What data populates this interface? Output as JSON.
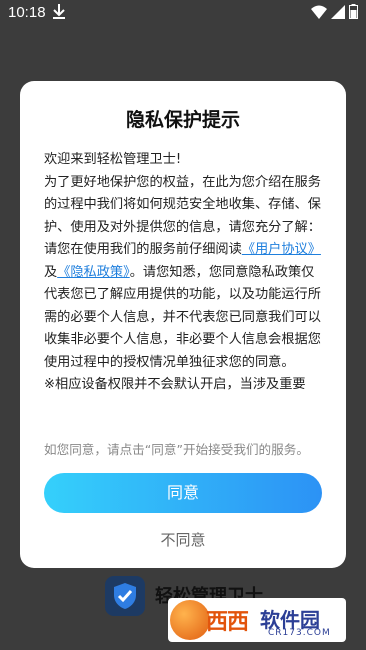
{
  "status_bar": {
    "time": "10:18"
  },
  "dialog": {
    "title": "隐私保护提示",
    "greeting": "欢迎来到轻松管理卫士!",
    "para1": "为了更好地保护您的权益，在此为您介绍在服务的过程中我们将如何规范安全地收集、存储、保护、使用及对外提供您的信息，请您充分了解：",
    "para2_prefix": "请您在使用我们的服务前仔细阅读",
    "user_agreement_link": "《用户协议》",
    "and_text": "及",
    "privacy_link": "《隐私政策》",
    "para2_suffix": "。请您知悉，您同意隐私政策仅代表您已了解应用提供的功能，以及功能运行所需的必要个人信息，并不代表您已同意我们可以收集非必要个人信息，非必要个人信息会根据您使用过程中的授权情况单独征求您的同意。",
    "para3": "※相应设备权限并不会默认开启，当涉及重要",
    "hint": "如您同意，请点击“同意”开始接受我们的服务。",
    "agree_label": "同意",
    "disagree_label": "不同意"
  },
  "background_app": {
    "name": "轻松管理卫士"
  },
  "watermark": {
    "xixi": "西西",
    "main": "软件园",
    "sub": "CR173.COM"
  },
  "colors": {
    "accent_start": "#35d0fb",
    "accent_end": "#2c92f5",
    "link": "#1f7fdd"
  }
}
